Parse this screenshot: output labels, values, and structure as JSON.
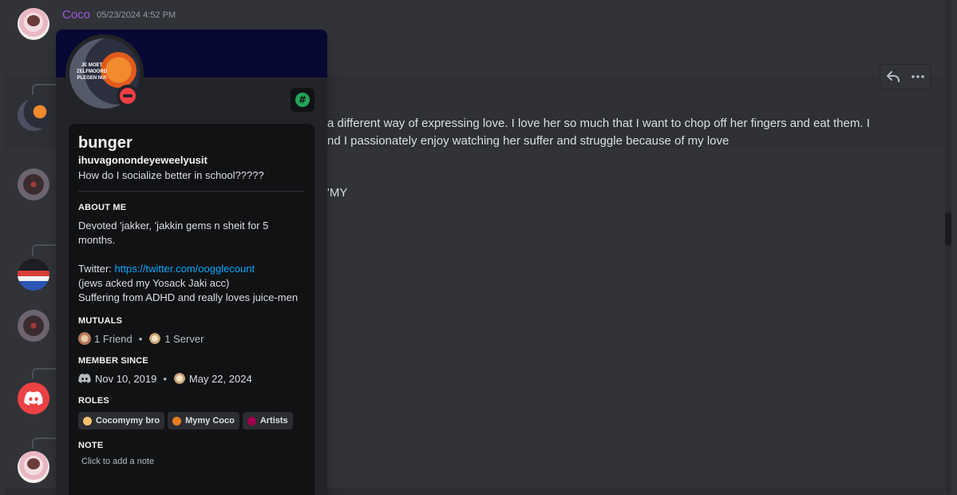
{
  "top_message": {
    "username": "Coco",
    "timestamp": "05/23/2024 4:52 PM"
  },
  "messages": {
    "line1": "a different way of expressing love. I love her so much that I want to chop off her fingers and eat them. I",
    "line2": "nd I passionately enjoy watching her suffer and struggle because of my love",
    "line3": "'MY"
  },
  "popout": {
    "avatar_text": "JE MOET ZELFMOORD PLEGEN NU!",
    "display_name": "bunger",
    "handle": "ihuvagonondeyeweelyusit",
    "custom_status": "How do I socialize better in school?????",
    "about_title": "ABOUT ME",
    "about_line1": "Devoted 'jakker, 'jakkin gems n sheit for 5 months.",
    "twitter_label": "Twitter: ",
    "twitter_link": "https://twitter.com/oogglecount",
    "about_line3": "(jews acked my Yosack Jaki acc)",
    "about_line4": "Suffering from ADHD and really loves juice-men",
    "mutuals_title": "MUTUALS",
    "mutual_friends": "1 Friend",
    "mutual_servers": "1 Server",
    "member_since_title": "MEMBER SINCE",
    "discord_since": "Nov 10, 2019",
    "server_since": "May 22, 2024",
    "roles_title": "ROLES",
    "roles": [
      {
        "label": "Cocomymy bro",
        "color": "#f5c26b"
      },
      {
        "label": "Mymy Coco",
        "color": "#e67e22"
      },
      {
        "label": "Artists",
        "color": "#a0004f"
      }
    ],
    "note_title": "NOTE",
    "note_placeholder": "Click to add a note"
  },
  "icons": {
    "reply": "reply-icon",
    "more": "more-icon",
    "badge": "hashtag-badge-icon",
    "status": "do-not-disturb-icon"
  },
  "colors": {
    "background": "#313338",
    "username_top": "#a05adf",
    "link": "#00a8fc",
    "banner": "#070833",
    "dnd": "#f23f43"
  }
}
